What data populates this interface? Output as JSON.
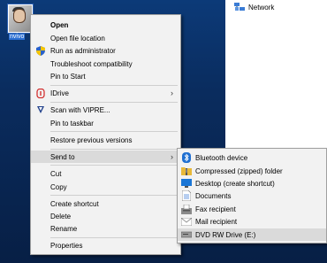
{
  "desktop": {
    "icon_label": "nvivo",
    "network_label": "Network"
  },
  "context_menu": {
    "items": [
      {
        "label": "Open",
        "bold": true
      },
      {
        "label": "Open file location"
      },
      {
        "label": "Run as administrator"
      },
      {
        "label": "Troubleshoot compatibility"
      },
      {
        "label": "Pin to Start"
      },
      {
        "label": "IDrive"
      },
      {
        "label": "Scan with VIPRE..."
      },
      {
        "label": "Pin to taskbar"
      },
      {
        "label": "Restore previous versions"
      },
      {
        "label": "Send to"
      },
      {
        "label": "Cut"
      },
      {
        "label": "Copy"
      },
      {
        "label": "Create shortcut"
      },
      {
        "label": "Delete"
      },
      {
        "label": "Rename"
      },
      {
        "label": "Properties"
      }
    ]
  },
  "send_to_menu": {
    "items": [
      {
        "label": "Bluetooth device"
      },
      {
        "label": "Compressed (zipped) folder"
      },
      {
        "label": "Desktop (create shortcut)"
      },
      {
        "label": "Documents"
      },
      {
        "label": "Fax recipient"
      },
      {
        "label": "Mail recipient"
      },
      {
        "label": "DVD RW Drive (E:)"
      }
    ]
  },
  "colors": {
    "desktop": "#0b2f63",
    "menu_bg": "#f2f2f2",
    "highlight": "#dadada"
  }
}
